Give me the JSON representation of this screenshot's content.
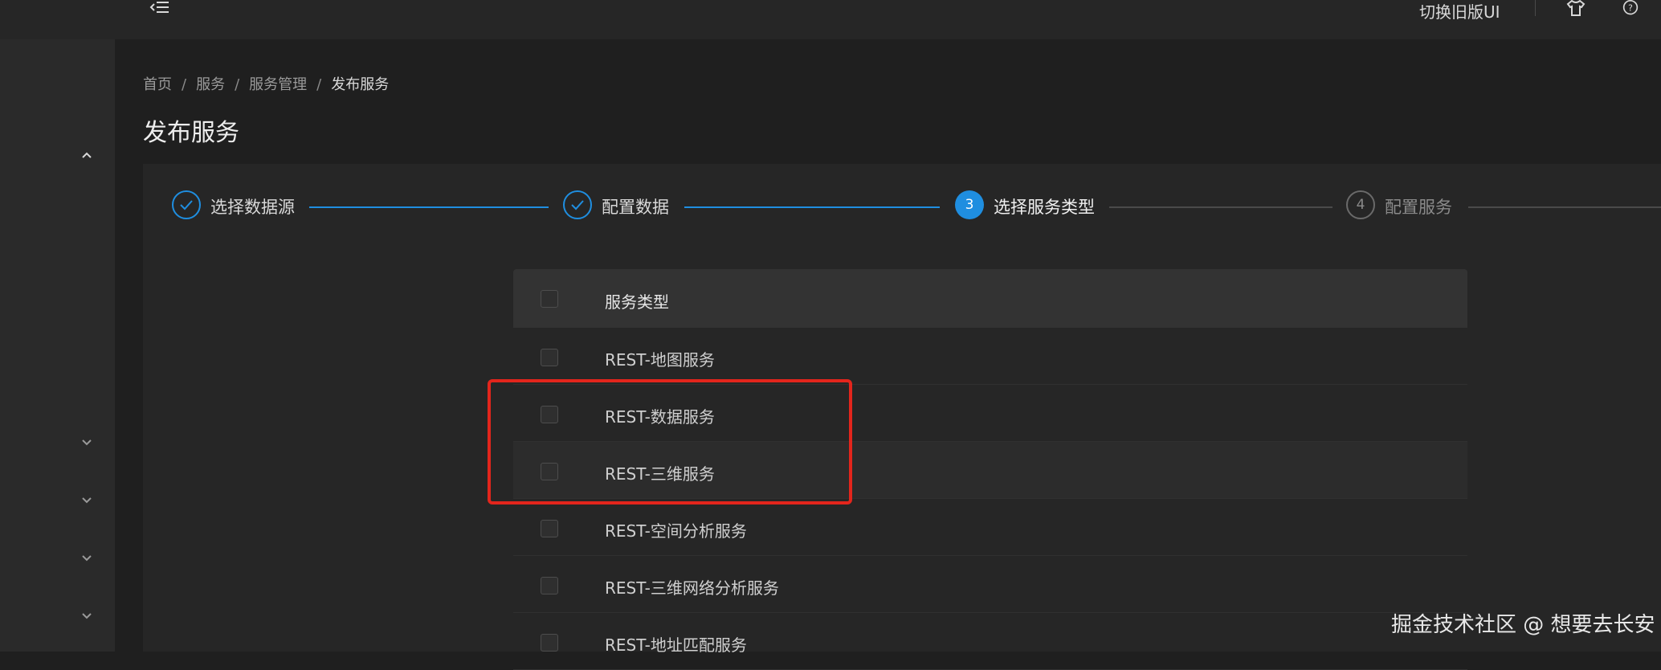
{
  "header": {
    "switch_ui_label": "切换旧版UI",
    "menu_icon": "menu-fold-icon",
    "theme_icon": "shirt-icon",
    "help_icon": "question-circle-icon"
  },
  "breadcrumb": {
    "items": [
      "首页",
      "服务",
      "服务管理",
      "发布服务"
    ],
    "separator": "/"
  },
  "page_title": "发布服务",
  "steps": [
    {
      "number": "",
      "label": "选择数据源",
      "status": "done"
    },
    {
      "number": "",
      "label": "配置数据",
      "status": "done"
    },
    {
      "number": "3",
      "label": "选择服务类型",
      "status": "active"
    },
    {
      "number": "4",
      "label": "配置服务",
      "status": "wait"
    }
  ],
  "table": {
    "header": "服务类型",
    "rows": [
      {
        "label": "REST-地图服务",
        "checked": false
      },
      {
        "label": "REST-数据服务",
        "checked": false
      },
      {
        "label": "REST-三维服务",
        "checked": false
      },
      {
        "label": "REST-空间分析服务",
        "checked": false
      },
      {
        "label": "REST-三维网络分析服务",
        "checked": false
      },
      {
        "label": "REST-地址匹配服务",
        "checked": false
      }
    ]
  },
  "watermark": "掘金技术社区 @ 想要去长安",
  "colors": {
    "accent": "#1f8ee0",
    "highlight": "#e3251c",
    "background": "#1f1f1f"
  }
}
